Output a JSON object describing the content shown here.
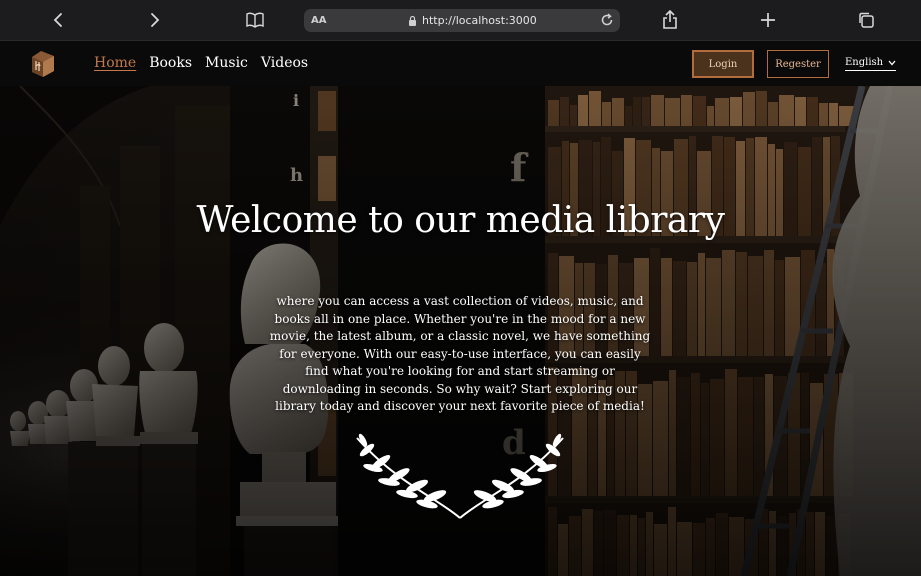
{
  "browser": {
    "text_size_label": "AA",
    "url": "http://localhost:3000"
  },
  "nav": {
    "links": [
      {
        "label": "Home",
        "active": true
      },
      {
        "label": "Books",
        "active": false
      },
      {
        "label": "Music",
        "active": false
      },
      {
        "label": "Videos",
        "active": false
      }
    ],
    "login_label": "Login",
    "register_label": "Regester",
    "language": "English"
  },
  "hero": {
    "title": "Welcome to our media library",
    "body": "where you can access a vast collection of videos, music, and books all in one place. Whether you're in the mood for a new movie, the latest album, or a classic novel, we have something for everyone. With our easy-to-use interface, you can easily find what you're looking for and start streaming or downloading in seconds. So why wait? Start exploring our library today and discover your next favorite piece of media!"
  },
  "colors": {
    "accent": "#c27a4c",
    "navbar_bg": "#0a0a0a",
    "browser_bar_bg": "#1c1c1e"
  }
}
